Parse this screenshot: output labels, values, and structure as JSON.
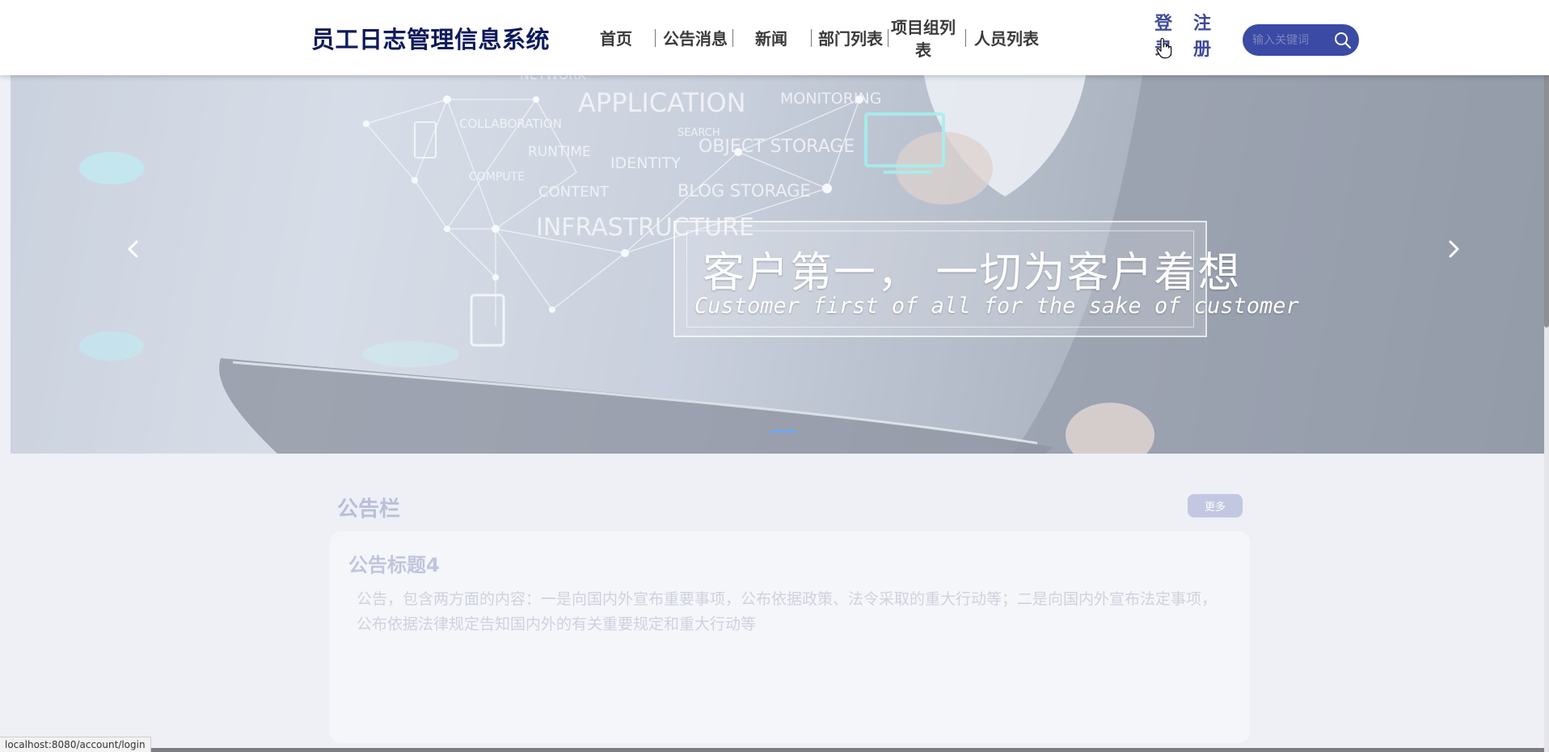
{
  "header": {
    "logo": "员工日志管理信息系统",
    "nav": [
      {
        "label": "首页"
      },
      {
        "label": "公告消息"
      },
      {
        "label": "新闻"
      },
      {
        "label": "部门列表"
      },
      {
        "label": "项目组列表"
      },
      {
        "label": "人员列表"
      }
    ],
    "login_label": "登录",
    "register_label": "注册",
    "search": {
      "placeholder": "输入关键词",
      "icon": "search-icon"
    },
    "colors": {
      "accent": "#3b4aa5",
      "logo": "#0d1a5c"
    }
  },
  "banner": {
    "slogan_cn": "客户第一，  一切为客户着想",
    "slogan_en": "Customer first of all for the sake of customer",
    "background_words": [
      "NETWORK",
      "APPLICATION",
      "MONITORING",
      "COLLABORATION",
      "SEARCH",
      "RUNTIME",
      "IDENTITY",
      "OBJECT STORAGE",
      "COMPUTE",
      "CONTENT",
      "BLOG STORAGE",
      "INFRASTRUCTURE"
    ],
    "prev_icon": "chevron-left-icon",
    "next_icon": "chevron-right-icon",
    "active_slide": 1,
    "slide_count": 1
  },
  "notice": {
    "section_title": "公告栏",
    "more_label": "更多",
    "card": {
      "title": "公告标题4",
      "text": "公告，包含两方面的内容：一是向国内外宣布重要事项，公布依据政策、法令采取的重大行动等；二是向国内外宣布法定事项，公布依据法律规定告知国内外的有关重要规定和重大行动等"
    }
  },
  "status_bar": {
    "url": "localhost:8080/account/login"
  }
}
